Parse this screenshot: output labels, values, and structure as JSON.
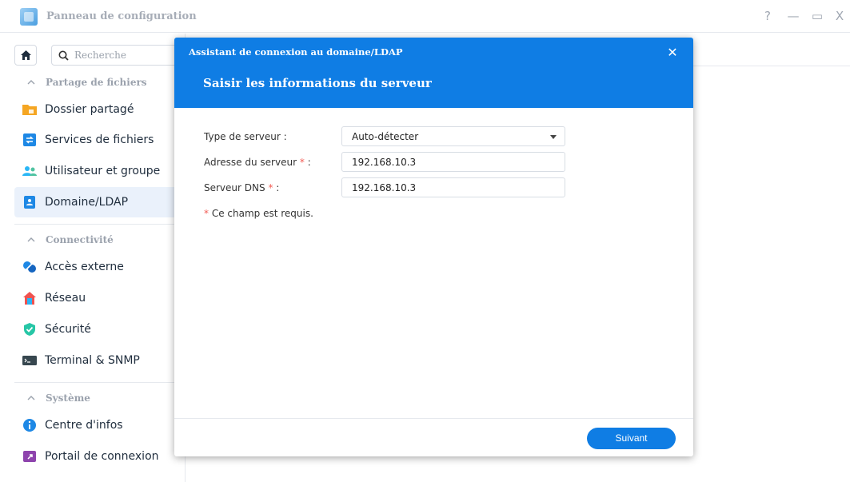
{
  "window": {
    "title": "Panneau de configuration",
    "controls": {
      "help": "?",
      "minimize": "—",
      "maximize": "▭",
      "close": "X"
    }
  },
  "sidebar": {
    "search_placeholder": "Recherche",
    "sections": [
      {
        "label": "Partage de fichiers",
        "items": [
          {
            "label": "Dossier partagé",
            "icon": "shared-folder-icon",
            "color": "#f5a623"
          },
          {
            "label": "Services de fichiers",
            "icon": "file-services-icon",
            "color": "#1e88e5"
          },
          {
            "label": "Utilisateur et groupe",
            "icon": "user-group-icon",
            "color": "#29b6f6"
          },
          {
            "label": "Domaine/LDAP",
            "icon": "domain-ldap-icon",
            "color": "#1e88e5",
            "active": true
          }
        ]
      },
      {
        "label": "Connectivité",
        "items": [
          {
            "label": "Accès externe",
            "icon": "external-access-icon",
            "color": "#1e88e5"
          },
          {
            "label": "Réseau",
            "icon": "network-home-icon",
            "color": "#ef5350"
          },
          {
            "label": "Sécurité",
            "icon": "security-shield-icon",
            "color": "#26c6a6"
          },
          {
            "label": "Terminal & SNMP",
            "icon": "terminal-icon",
            "color": "#37474f"
          }
        ]
      },
      {
        "label": "Système",
        "items": [
          {
            "label": "Centre d'infos",
            "icon": "info-center-icon",
            "color": "#1e88e5"
          },
          {
            "label": "Portail de connexion",
            "icon": "login-portal-icon",
            "color": "#8e44ad"
          }
        ]
      }
    ]
  },
  "dialog": {
    "title": "Assistant de connexion au domaine/LDAP",
    "close": "✕",
    "heading": "Saisir les informations du serveur",
    "fields": {
      "server_type": {
        "label": "Type de serveur :",
        "value": "Auto-détecter"
      },
      "server_address": {
        "label": "Adresse du serveur",
        "required": "*",
        "suffix": ":",
        "value": "192.168.10.3"
      },
      "dns_server": {
        "label": "Serveur DNS",
        "required": "*",
        "suffix": ":",
        "value": "192.168.10.3"
      }
    },
    "required_note": {
      "star": "*",
      "text": "Ce champ est requis."
    },
    "next_button": "Suivant"
  },
  "colors": {
    "accent": "#0f7de4",
    "required": "#f25c54",
    "active_bg": "#eaf1fb"
  }
}
